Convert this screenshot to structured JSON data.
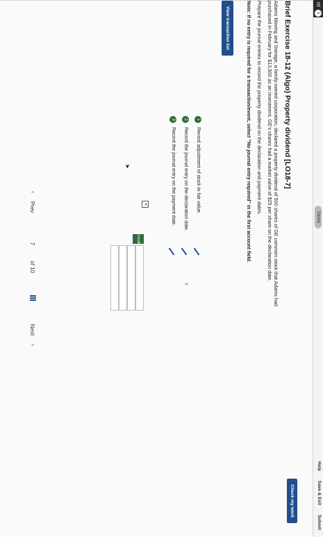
{
  "header": {
    "corner_label": "nt",
    "info_glyph": "i",
    "saved_label": "Saved",
    "links": [
      "Help",
      "Save & Exit",
      "Submit"
    ]
  },
  "check_button": "Check my work",
  "problem": {
    "title": "Brief Exercise 18-12 (Algo) Property dividend [LO18-7]",
    "paragraphs": [
      "Adams Moving and Storage, a family-owned corporation, declared a property dividend of 500 shares of GE common stock that Adams had purchased in February for $13,500 as an investment. GE's shares had a market value of $25 per share on the declaration date.",
      "Prepare the journal entries to record the property dividend on the declaration and payment dates."
    ],
    "note": "Note: If no entry is required for a transaction/event, select \"No journal entry required\" in the first account field."
  },
  "view_button": "View transaction list",
  "steps": [
    {
      "num": "1",
      "label": "Record adjustment of stock to fair value."
    },
    {
      "num": "2",
      "label": "Record the journal entry on the declaration date."
    },
    {
      "num": "3",
      "label": "Record the journal entry on the payment date."
    }
  ],
  "grid": {
    "credit_label": "Credit"
  },
  "pager": {
    "prev": "Prev",
    "current": "7",
    "of": "of 10",
    "next": "Next"
  },
  "colors": {
    "accent": "#1f4e8c",
    "step": "#2f6b3a"
  }
}
